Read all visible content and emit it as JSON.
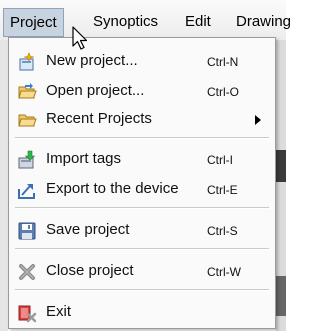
{
  "menubar": {
    "items": [
      {
        "label": "Project"
      },
      {
        "label": "Synoptics"
      },
      {
        "label": "Edit"
      },
      {
        "label": "Drawing"
      }
    ]
  },
  "dropdown": {
    "items": [
      {
        "label": "New project...",
        "shortcut": "Ctrl-N",
        "icon": "new-project-icon"
      },
      {
        "label": "Open project...",
        "shortcut": "Ctrl-O",
        "icon": "open-folder-icon"
      },
      {
        "label": "Recent Projects",
        "shortcut": "",
        "icon": "recent-folder-icon"
      },
      {
        "label": "Import tags",
        "shortcut": "Ctrl-I",
        "icon": "import-tags-icon"
      },
      {
        "label": "Export to the device",
        "shortcut": "Ctrl-E",
        "icon": "export-device-icon"
      },
      {
        "label": "Save project",
        "shortcut": "Ctrl-S",
        "icon": "save-disk-icon"
      },
      {
        "label": "Close project",
        "shortcut": "Ctrl-W",
        "icon": "close-x-icon"
      },
      {
        "label": "Exit",
        "shortcut": "",
        "icon": "exit-icon"
      }
    ]
  },
  "colors": {
    "menubar_active_bg": "#c8d3e0",
    "menu_bg": "#fafafa",
    "separator": "#c9c9c9"
  }
}
